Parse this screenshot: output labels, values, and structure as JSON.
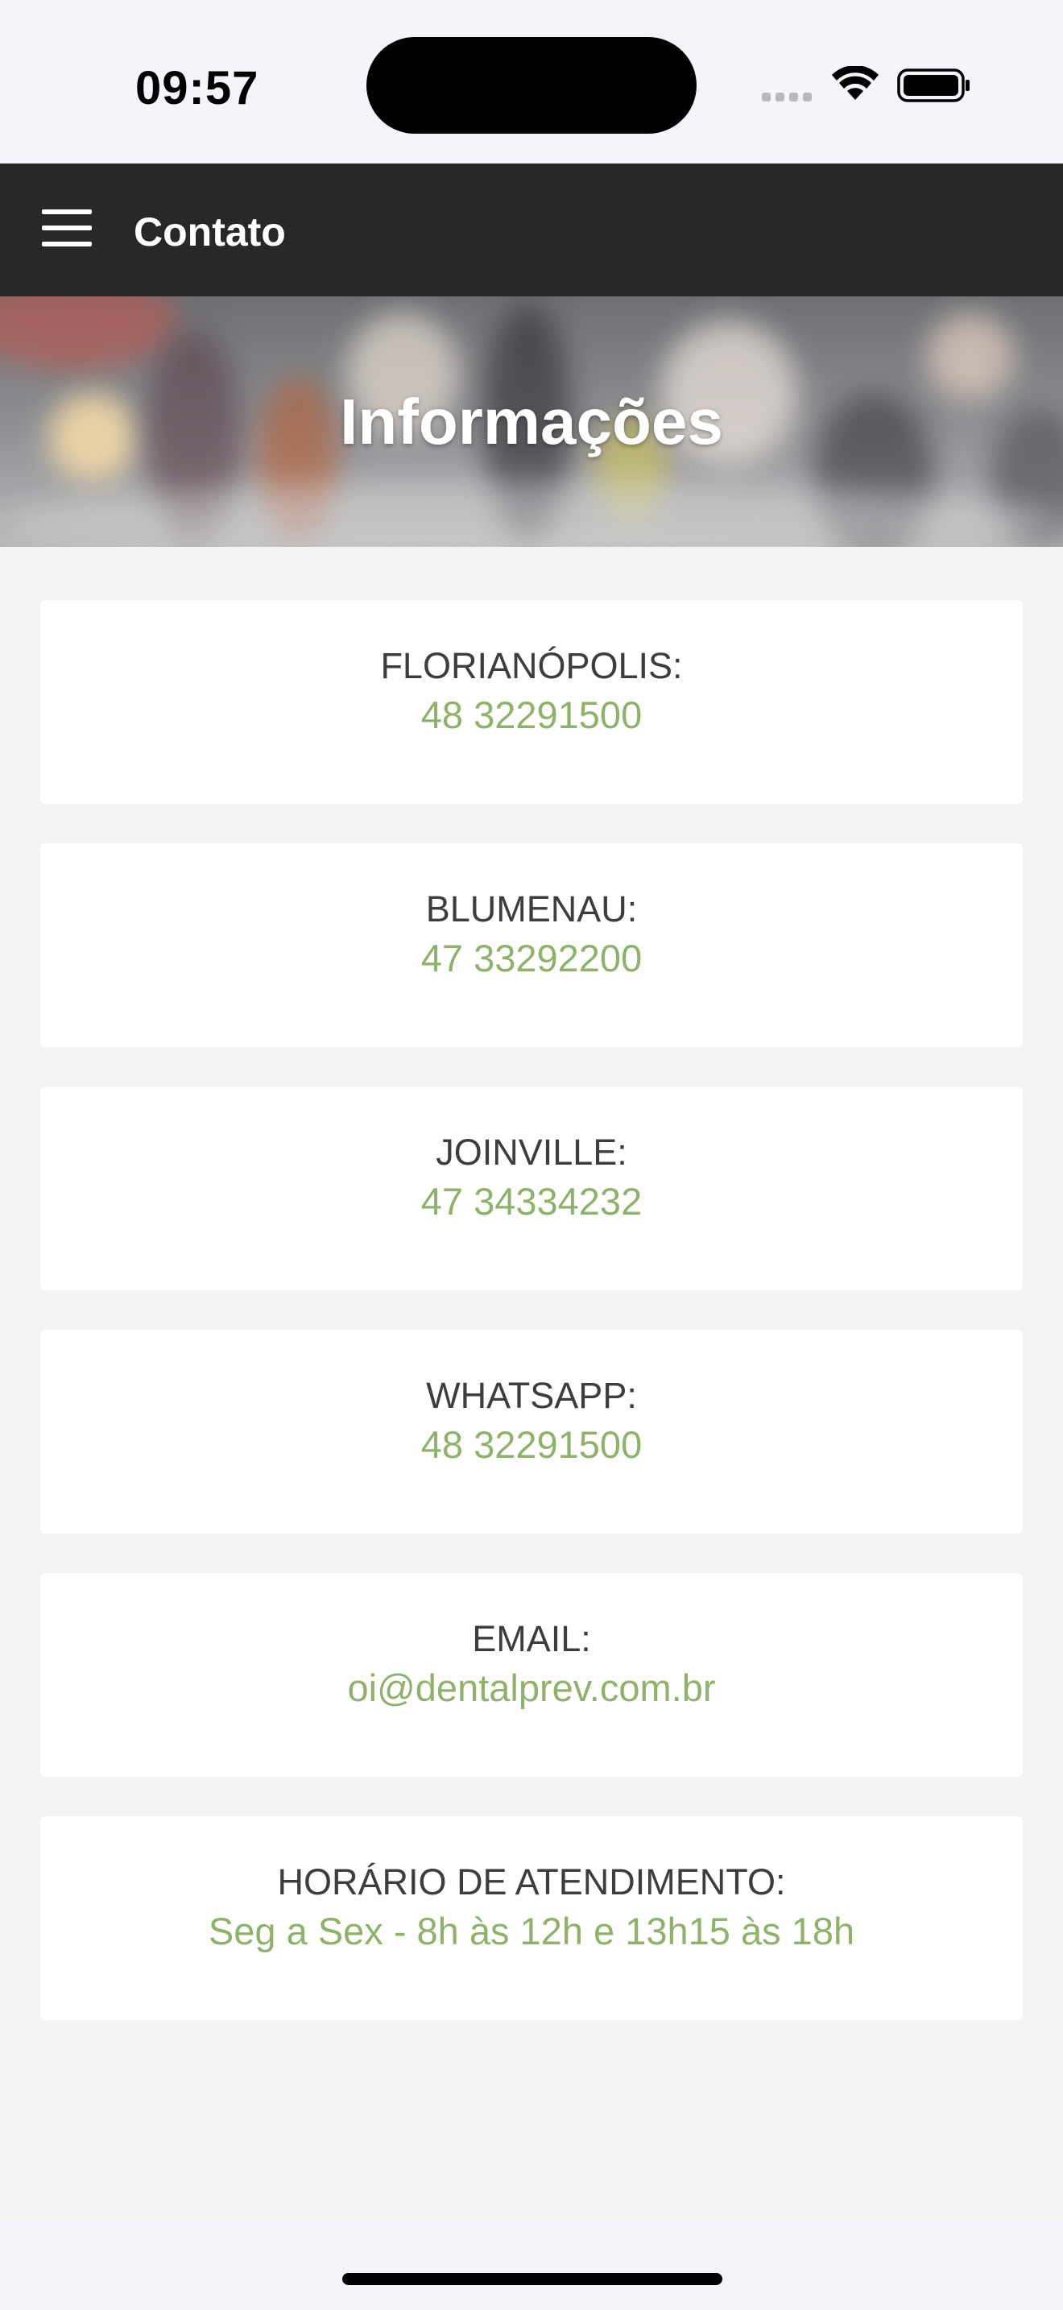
{
  "status_bar": {
    "time": "09:57"
  },
  "app_bar": {
    "title": "Contato",
    "menu_icon": "hamburger-menu-icon"
  },
  "banner": {
    "title": "Informações"
  },
  "colors": {
    "app_bar_bg": "#282828",
    "accent_green": "#8fb26a",
    "label_text": "#3d3d3d",
    "page_bg": "#f3f3f3"
  },
  "contacts": [
    {
      "label": "FLORIANÓPOLIS:",
      "value": "48 32291500"
    },
    {
      "label": "BLUMENAU:",
      "value": "47 33292200"
    },
    {
      "label": "JOINVILLE:",
      "value": "47 34334232"
    },
    {
      "label": "WHATSAPP:",
      "value": "48 32291500"
    },
    {
      "label": "EMAIL:",
      "value": "oi@dentalprev.com.br"
    },
    {
      "label": "HORÁRIO DE ATENDIMENTO:",
      "value": "Seg a Sex - 8h às 12h e 13h15 às 18h"
    }
  ]
}
